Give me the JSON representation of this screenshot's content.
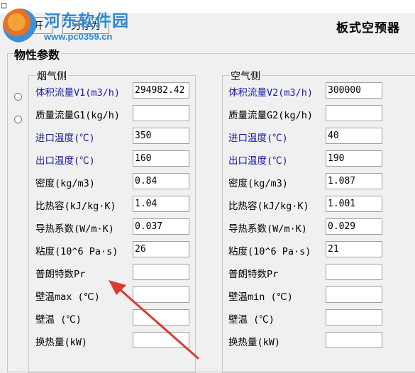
{
  "window": {
    "system_icon": "□"
  },
  "toolbar": {
    "open_label": "打开",
    "save_as_label": "另存为"
  },
  "app_title": "板式空预器",
  "watermark": {
    "site_name": "河东软件园",
    "url": "www.pc0359.cn"
  },
  "properties_group": {
    "title": "物性参数"
  },
  "flue_gas": {
    "title": "烟气侧",
    "rows": [
      {
        "label": "体积流量V1(m3/h)",
        "value": "294982.42",
        "highlight": true
      },
      {
        "label": "质量流量G1(kg/h)",
        "value": "",
        "highlight": false
      },
      {
        "label": "进口温度(℃)",
        "value": "350",
        "highlight": true
      },
      {
        "label": "出口温度(℃)",
        "value": "160",
        "highlight": true
      },
      {
        "label": "密度(kg/m3)",
        "value": "0.84",
        "highlight": false
      },
      {
        "label": "比热容(kJ/kg·K)",
        "value": "1.04",
        "highlight": false
      },
      {
        "label": "导热系数(W/m·K)",
        "value": "0.037",
        "highlight": false
      },
      {
        "label": "粘度(10^6 Pa·s)",
        "value": "26",
        "highlight": false
      },
      {
        "label": "普朗特数Pr",
        "value": "",
        "highlight": false
      },
      {
        "label": "壁温max (℃)",
        "value": "",
        "highlight": false
      },
      {
        "label": "壁温 (℃)",
        "value": "",
        "highlight": false
      },
      {
        "label": "换热量(kW)",
        "value": "",
        "highlight": false
      }
    ]
  },
  "air": {
    "title": "空气侧",
    "rows": [
      {
        "label": "体积流量V2(m3/h)",
        "value": "300000",
        "highlight": true
      },
      {
        "label": "质量流量G2(kg/h)",
        "value": "",
        "highlight": false
      },
      {
        "label": "进口温度(℃)",
        "value": "40",
        "highlight": true
      },
      {
        "label": "出口温度(℃)",
        "value": "190",
        "highlight": true
      },
      {
        "label": "密度(kg/m3)",
        "value": "1.087",
        "highlight": false
      },
      {
        "label": "比热容(kJ/kg·K)",
        "value": "1.001",
        "highlight": false
      },
      {
        "label": "导热系数(W/m·K)",
        "value": "0.029",
        "highlight": false
      },
      {
        "label": "粘度(10^6 Pa·s)",
        "value": "21",
        "highlight": false
      },
      {
        "label": "普朗特数Pr",
        "value": "",
        "highlight": false
      },
      {
        "label": "壁温min (℃)",
        "value": "",
        "highlight": false
      },
      {
        "label": "壁温 (℃)",
        "value": "",
        "highlight": false
      },
      {
        "label": "换热量(kW)",
        "value": "",
        "highlight": false
      }
    ]
  },
  "colors": {
    "label_highlight": "#1a1aa6",
    "arrow": "#d93a34",
    "watermark": "#2d86d4"
  }
}
